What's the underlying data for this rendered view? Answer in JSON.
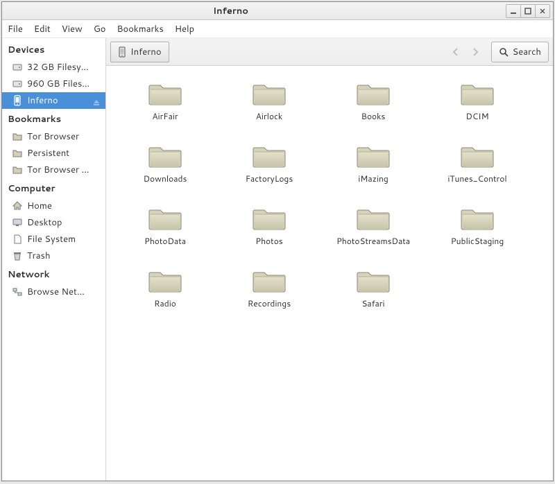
{
  "window": {
    "title": "Inferno"
  },
  "menubar": [
    "File",
    "Edit",
    "View",
    "Go",
    "Bookmarks",
    "Help"
  ],
  "toolbar": {
    "path": "Inferno",
    "search_label": "Search"
  },
  "sidebar": {
    "sections": [
      {
        "title": "Devices",
        "items": [
          {
            "icon": "drive",
            "label": "32 GB Filesy…",
            "selected": false
          },
          {
            "icon": "drive",
            "label": "960 GB Files…",
            "selected": false
          },
          {
            "icon": "phone",
            "label": "Inferno",
            "selected": true,
            "eject": true
          }
        ]
      },
      {
        "title": "Bookmarks",
        "items": [
          {
            "icon": "folder",
            "label": "Tor Browser"
          },
          {
            "icon": "folder",
            "label": "Persistent"
          },
          {
            "icon": "folder",
            "label": "Tor Browser …"
          }
        ]
      },
      {
        "title": "Computer",
        "items": [
          {
            "icon": "home",
            "label": "Home"
          },
          {
            "icon": "desktop",
            "label": "Desktop"
          },
          {
            "icon": "file",
            "label": "File System"
          },
          {
            "icon": "trash",
            "label": "Trash"
          }
        ]
      },
      {
        "title": "Network",
        "items": [
          {
            "icon": "network",
            "label": "Browse Net…"
          }
        ]
      }
    ]
  },
  "folders": [
    "AirFair",
    "Airlock",
    "Books",
    "DCIM",
    "Downloads",
    "FactoryLogs",
    "iMazing",
    "iTunes_Control",
    "PhotoData",
    "Photos",
    "PhotoStreamsData",
    "PublicStaging",
    "Radio",
    "Recordings",
    "Safari"
  ]
}
